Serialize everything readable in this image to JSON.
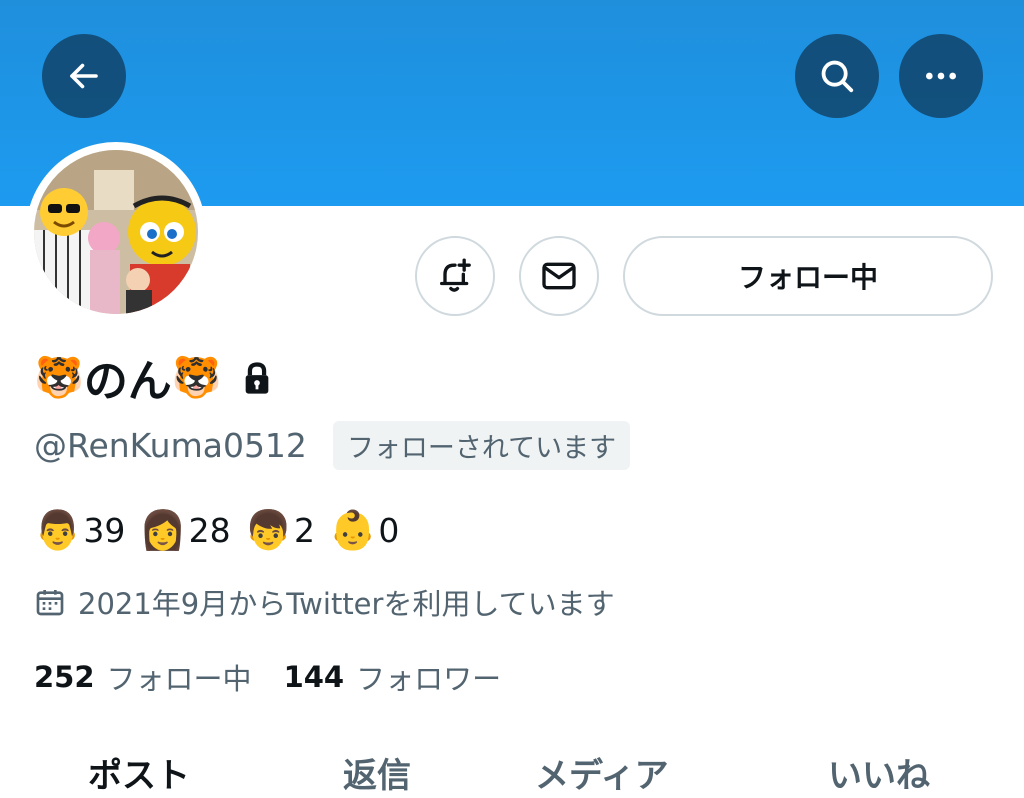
{
  "header": {
    "back_icon": "arrow-left-icon",
    "search_icon": "search-icon",
    "more_icon": "more-horizontal-icon",
    "banner_color": "#1d9bf0"
  },
  "profile": {
    "avatar_icon": "avatar-photo",
    "display_name": "のん",
    "name_emoji": "🐯",
    "protected_icon": "lock-icon",
    "handle": "@RenKuma0512",
    "follows_you": "フォローされています",
    "bio": [
      {
        "emoji": "👨",
        "value": "39"
      },
      {
        "emoji": "👩",
        "value": "28"
      },
      {
        "emoji": "👦",
        "value": "2"
      },
      {
        "emoji": "👶",
        "value": "0"
      }
    ],
    "joined": "2021年9月からTwitterを利用しています",
    "following_count": "252",
    "following_label": "フォロー中",
    "followers_count": "144",
    "followers_label": "フォロワー"
  },
  "actions": {
    "notify_icon": "bell-plus-icon",
    "dm_icon": "envelope-icon",
    "follow_label": "フォロー中"
  },
  "tabs": [
    {
      "label": "ポスト",
      "active": true
    },
    {
      "label": "返信",
      "active": false
    },
    {
      "label": "メディア",
      "active": false
    },
    {
      "label": "いいね",
      "active": false
    }
  ]
}
